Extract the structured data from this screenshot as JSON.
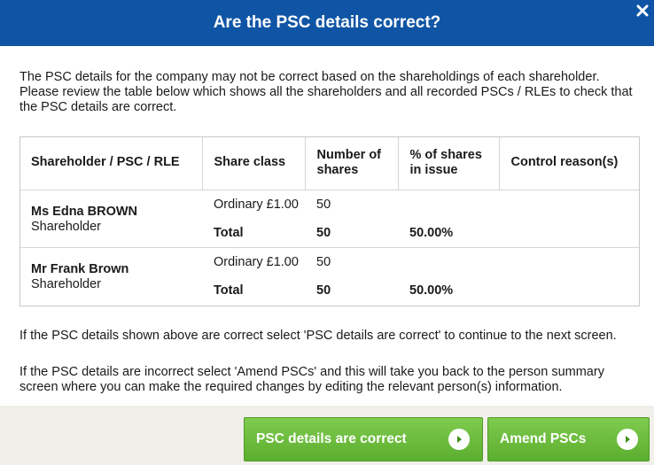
{
  "dialog": {
    "title": "Are the PSC details correct?"
  },
  "intro": {
    "text": "The PSC details for the company may not be correct based on the shareholdings of each shareholder. Please review the table below which shows all the shareholders and all recorded PSCs / RLEs to check that the PSC details are correct."
  },
  "table": {
    "headers": [
      "Shareholder / PSC / RLE",
      "Share class",
      "Number of shares",
      "% of shares in issue",
      "Control reason(s)"
    ],
    "rows": [
      {
        "name": "Ms Edna BROWN",
        "role": "Shareholder",
        "share_class": "Ordinary £1.00",
        "shares": "50",
        "total_label": "Total",
        "total_shares": "50",
        "total_percent": "50.00%"
      },
      {
        "name": "Mr Frank Brown",
        "role": "Shareholder",
        "share_class": "Ordinary £1.00",
        "shares": "50",
        "total_label": "Total",
        "total_shares": "50",
        "total_percent": "50.00%"
      }
    ]
  },
  "instructions": {
    "correct": "If the PSC details shown above are correct select 'PSC details are correct' to continue to the next screen.",
    "incorrect": "If the PSC details are incorrect select 'Amend PSCs' and this will take you back to the person summary screen where you can make the required changes by editing the relevant person(s) information."
  },
  "buttons": {
    "correct_label": "PSC details are correct",
    "amend_label": "Amend PSCs"
  },
  "colors": {
    "header_bg": "#1055a5",
    "button_green": "#5cae2f",
    "footer_bg": "#f1efea"
  },
  "icons": {
    "close": "close-icon",
    "arrow": "chevron-right-circle-icon"
  }
}
